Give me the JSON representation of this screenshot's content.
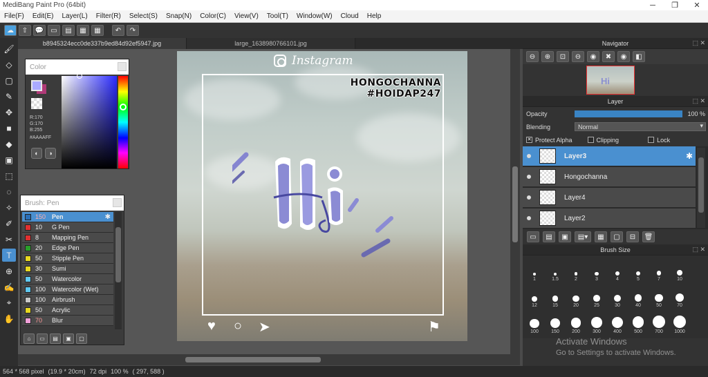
{
  "window": {
    "title": "MediBang Paint Pro (64bit)",
    "min": "─",
    "restore": "❐",
    "close": "✕"
  },
  "menu": [
    "File(F)",
    "Edit(E)",
    "Layer(L)",
    "Filter(R)",
    "Select(S)",
    "Snap(N)",
    "Color(C)",
    "View(V)",
    "Tool(T)",
    "Window(W)",
    "Cloud",
    "Help"
  ],
  "toolbar": [
    "☁",
    "⇧",
    "💬",
    "▭",
    "▤",
    "▦",
    "▦",
    "↶",
    "↷"
  ],
  "tools": [
    "🖌",
    "◇",
    "▢",
    "✎",
    "✥",
    "■",
    "◆",
    "▣",
    "⬚",
    "◌",
    "✧",
    "✐",
    "✂",
    "T",
    "⊕",
    "✍",
    "⌖",
    "✋"
  ],
  "tabs": [
    {
      "label": "b8945324ecc0de337b9ed84d92ef5947.jpg"
    },
    {
      "label": "large_1638980766101.jpg"
    }
  ],
  "artwork": {
    "instagram_label": "Instagram",
    "hashtag1": "HONGOCHANNA",
    "hashtag2": "#HOIDAP247",
    "heart": "♥",
    "comment": "○",
    "share": "➤",
    "bookmark": "⚑"
  },
  "color_panel": {
    "title": "Color",
    "r": "R:170",
    "g": "G:170",
    "b": "B:255",
    "hex": "#AAAAFF",
    "fg_color": "#aaaaff",
    "btn1": "◐",
    "btn2": "◑"
  },
  "brush_panel": {
    "title": "Brush: Pen",
    "gear": "✱",
    "items": [
      {
        "size": "150",
        "name": "Pen",
        "color": "#2a6fb8",
        "selected": true
      },
      {
        "size": "10",
        "name": "G Pen",
        "color": "#e03030"
      },
      {
        "size": "8",
        "name": "Mapping Pen",
        "color": "#e03030"
      },
      {
        "size": "20",
        "name": "Edge Pen",
        "color": "#2aa02a"
      },
      {
        "size": "50",
        "name": "Stipple Pen",
        "color": "#e8d820"
      },
      {
        "size": "30",
        "name": "Sumi",
        "color": "#e8d820"
      },
      {
        "size": "50",
        "name": "Watercolor",
        "color": "#60c8f0"
      },
      {
        "size": "100",
        "name": "Watercolor (Wet)",
        "color": "#60c8f0"
      },
      {
        "size": "100",
        "name": "Airbrush",
        "color": "#c8c8c8"
      },
      {
        "size": "50",
        "name": "Acrylic",
        "color": "#e8d820"
      },
      {
        "size": "70",
        "name": "Blur",
        "color": "#f0a0d8",
        "size_color": "#ff9999"
      }
    ],
    "bottom_buttons": [
      "⌂",
      "▭",
      "▤",
      "▣",
      "▢"
    ]
  },
  "navigator": {
    "title": "Navigator",
    "tools": [
      "⊖",
      "⊕",
      "⊡",
      "⊖",
      "◉",
      "✖",
      "◉",
      "◧"
    ],
    "thumb_text": "Hi"
  },
  "layer_panel": {
    "title": "Layer",
    "opacity_label": "Opacity",
    "opacity_value": "100 %",
    "opacity_fraction": 1.0,
    "blending_label": "Blending",
    "blending_value": "Normal",
    "protect_alpha": "Protect Alpha",
    "protect_alpha_checked": true,
    "clipping": "Clipping",
    "lock": "Lock",
    "layers": [
      {
        "name": "Layer3",
        "selected": true
      },
      {
        "name": "Hongochanna"
      },
      {
        "name": "Layer4"
      },
      {
        "name": "Layer2"
      }
    ],
    "tools": [
      "▭",
      "▤",
      "▣",
      "▤▾",
      "▦",
      "▢",
      "⊟",
      "🗑"
    ]
  },
  "brush_size_panel": {
    "title": "Brush Size",
    "sizes": [
      "1",
      "1.5",
      "2",
      "3",
      "4",
      "5",
      "7",
      "10",
      "12",
      "15",
      "20",
      "25",
      "30",
      "40",
      "50",
      "70",
      "100",
      "150",
      "200",
      "300",
      "400",
      "500",
      "700",
      "1000"
    ]
  },
  "panel_icons": "⬚ ✕",
  "status": {
    "dimensions": "564 * 568 pixel",
    "physical": "(19.9 * 20cm)",
    "dpi": "72 dpi",
    "zoom": "100 %",
    "coords": "( 297, 588 )"
  },
  "watermark": {
    "title": "Activate Windows",
    "subtitle": "Go to Settings to activate Windows."
  }
}
